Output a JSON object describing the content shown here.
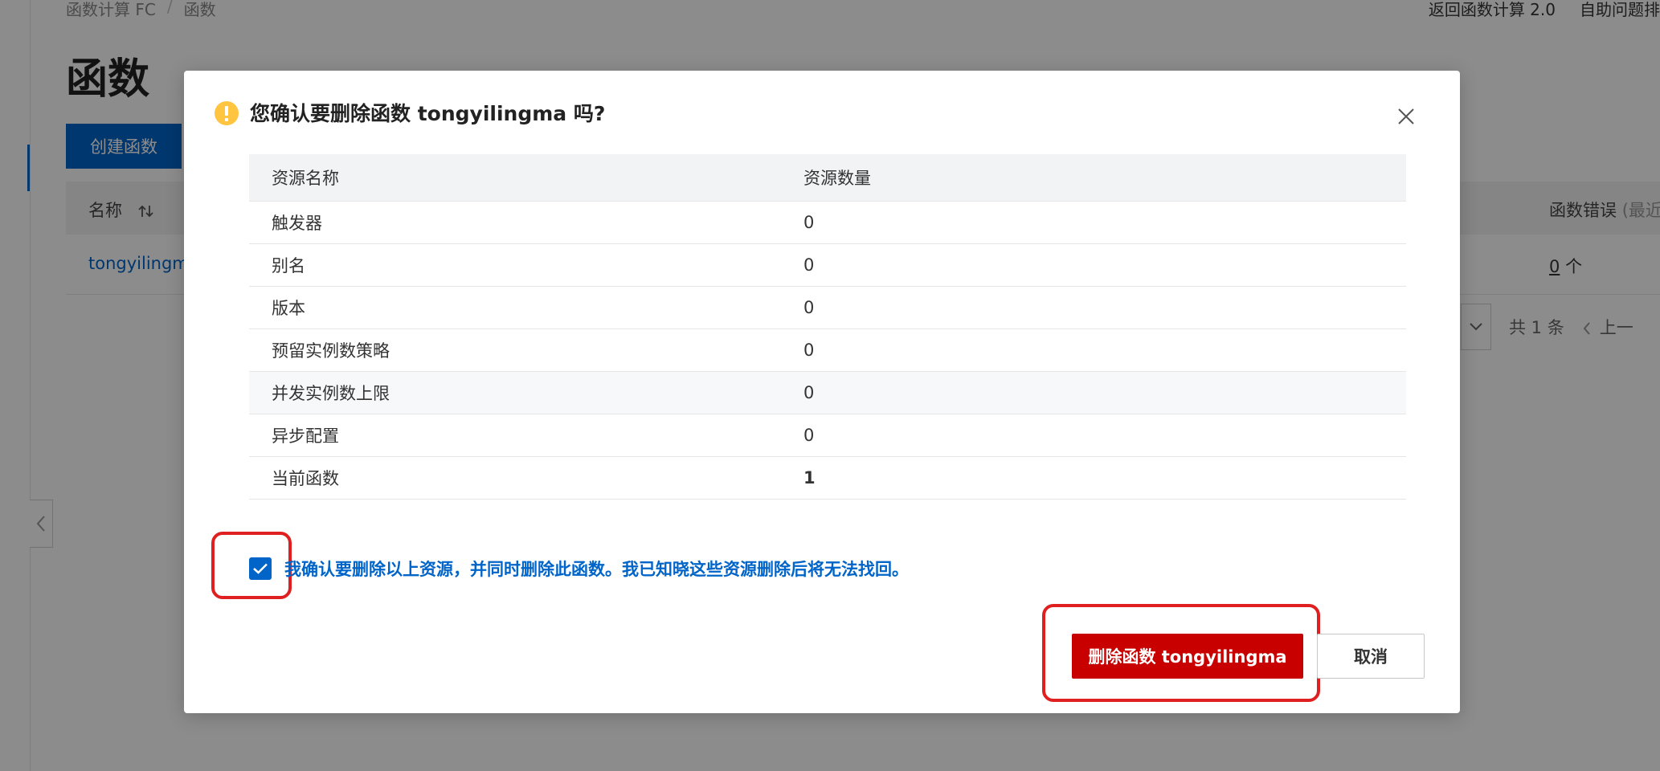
{
  "background": {
    "breadcrumb": [
      "函数计算 FC",
      "/",
      "函数"
    ],
    "top_links": [
      "返回函数计算 2.0",
      "自助问题排"
    ],
    "page_title": "函数",
    "create_button": "创建函数",
    "table": {
      "col_name": "名称",
      "col_sort_icon": "sort-icon",
      "col_error": "函数错误",
      "col_error_suffix": "(最近",
      "row_name": "tongyilingm",
      "row_error_value": "0",
      "row_error_unit": "个"
    },
    "pager": {
      "total": "共 1 条",
      "prev": "上一"
    }
  },
  "dialog": {
    "icon": "warning-icon",
    "title": "您确认要删除函数 tongyilingma 吗?",
    "table": {
      "headers": [
        "资源名称",
        "资源数量"
      ],
      "rows": [
        {
          "name": "触发器",
          "count": "0"
        },
        {
          "name": "别名",
          "count": "0"
        },
        {
          "name": "版本",
          "count": "0"
        },
        {
          "name": "预留实例数策略",
          "count": "0"
        },
        {
          "name": "并发实例数上限",
          "count": "0"
        },
        {
          "name": "异步配置",
          "count": "0"
        },
        {
          "name": "当前函数",
          "count": "1"
        }
      ]
    },
    "confirm_checked": true,
    "confirm_text": "我确认要删除以上资源，并同时删除此函数。我已知晓这些资源删除后将无法找回。",
    "delete_button": "删除函数 tongyilingma",
    "cancel_button": "取消"
  },
  "colors": {
    "primary": "#0064c8",
    "danger": "#c80000",
    "highlight": "#e02020",
    "warning": "#ffc440"
  }
}
